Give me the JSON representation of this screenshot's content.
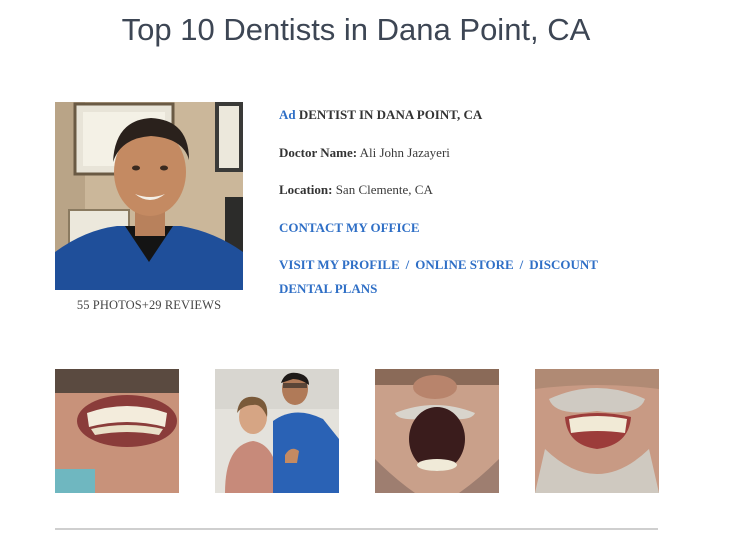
{
  "page": {
    "title": "Top 10 Dentists in Dana Point, CA"
  },
  "listing": {
    "photo_caption": "55 PHOTOS+29 REVIEWS",
    "ad_label": "Ad",
    "category": "DENTIST IN DANA POINT, CA",
    "doctor_label": "Doctor Name:",
    "doctor_name": "Ali John Jazayeri",
    "location_label": "Location:",
    "location": "San Clemente, CA",
    "contact_link": "CONTACT MY OFFICE",
    "profile_link": "VISIT MY PROFILE",
    "store_link": "ONLINE STORE",
    "discount_link": "DISCOUNT",
    "discount_link_cont": "DENTAL PLANS",
    "separator": "/"
  },
  "colors": {
    "link": "#2f6fc6",
    "title": "#3d4654",
    "scrubs": "#1f4f9a"
  }
}
